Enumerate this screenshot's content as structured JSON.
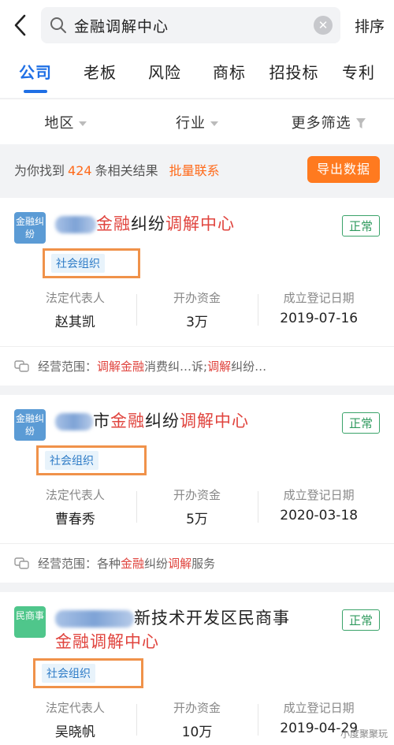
{
  "header": {
    "search_value": "金融调解中心",
    "sort_label": "排序"
  },
  "tabs": [
    "公司",
    "老板",
    "风险",
    "商标",
    "招投标",
    "专利"
  ],
  "filters": [
    "地区",
    "行业",
    "更多筛选"
  ],
  "result": {
    "prefix": "为你找到",
    "count": "424",
    "suffix": "条相关结果",
    "batch_label": "批量联系",
    "export_label": "导出数据"
  },
  "stat_labels": {
    "legal_rep": "法定代表人",
    "capital": "开办资金",
    "reg_date": "成立登记日期"
  },
  "scope_label": "经营范围：",
  "cards": [
    {
      "logo": "金融纠纷",
      "logo_color": "#5b9bd5",
      "title_parts": [
        "金融",
        "纠纷",
        "调解中心"
      ],
      "status": "正常",
      "tag": "社会组织",
      "legal_rep": "赵其凯",
      "capital": "3万",
      "reg_date": "2019-07-16",
      "scope_parts": [
        "调解金融",
        "消费纠…诉;",
        "调解",
        "纠纷…"
      ]
    },
    {
      "logo": "金融纠纷",
      "logo_color": "#5b9bd5",
      "title_parts": [
        "市",
        "金融",
        "纠纷",
        "调解中心"
      ],
      "status": "正常",
      "tag": "社会组织",
      "legal_rep": "曹春秀",
      "capital": "5万",
      "reg_date": "2020-03-18",
      "scope_parts": [
        "各种",
        "金融",
        "纠纷",
        "调解",
        "服务"
      ]
    },
    {
      "logo": "民商事",
      "logo_color": "#4fc68b",
      "title_parts": [
        "新技术开发区民商事",
        "金融调解中心"
      ],
      "status": "正常",
      "tag": "社会组织",
      "legal_rep": "吴晓帆",
      "capital": "10万",
      "reg_date": "2019-04-29"
    }
  ],
  "watermark": "小度聚聚玩"
}
